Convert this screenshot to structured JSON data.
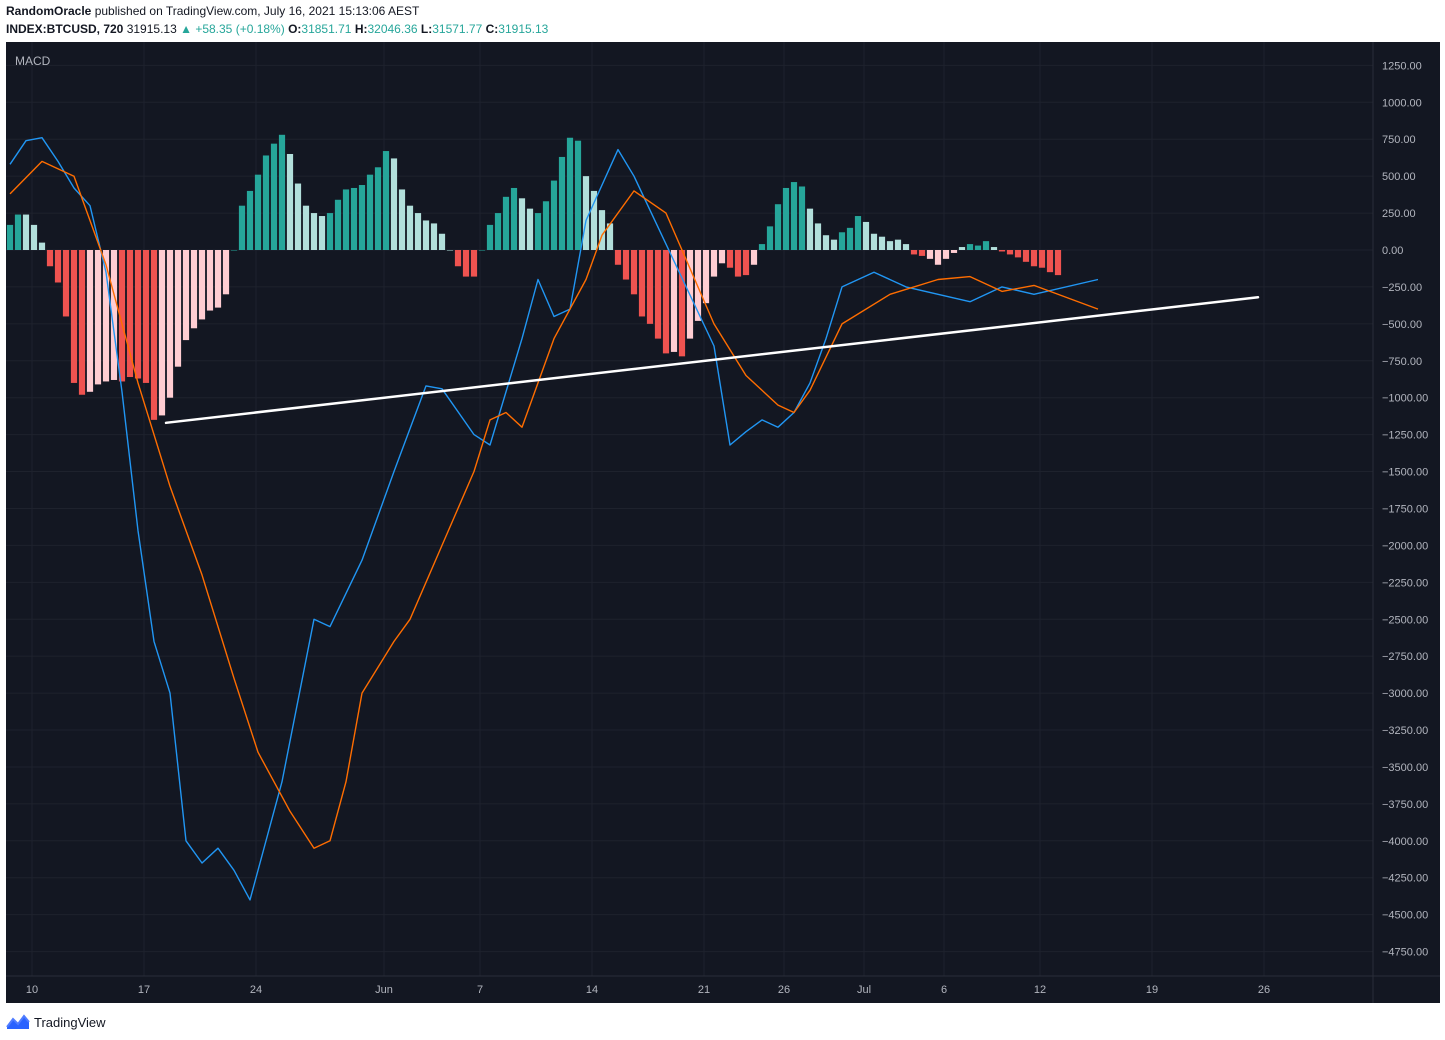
{
  "header": {
    "author": "RandomOracle",
    "published_text": "published on TradingView.com, July 16, 2021 15:13:06 AEST",
    "symbol": "INDEX:BTCUSD, 720",
    "last_price": "31915.13",
    "change": "▲ +58.35 (+0.18%)",
    "o_label": "O:",
    "o_value": "31851.71",
    "h_label": "H:",
    "h_value": "32046.36",
    "l_label": "L:",
    "l_value": "31571.77",
    "c_label": "C:",
    "c_value": "31915.13"
  },
  "footer": {
    "brand": "TradingView"
  },
  "colors": {
    "background": "#131722",
    "macd_line": "#2196f3",
    "signal_line": "#ff6d00",
    "hist_pos_strong": "#26a69a",
    "hist_pos_weak": "#b2dfdb",
    "hist_neg_strong": "#ef5350",
    "hist_neg_weak": "#ffcdd2",
    "trendline": "#ffffff",
    "axis_text": "#b2b5be"
  },
  "chart_data": {
    "type": "line",
    "title": "MACD",
    "xlabel": "",
    "ylabel": "",
    "ylim": [
      -4900,
      1400
    ],
    "x_ticks": [
      {
        "i": 0,
        "label": "10"
      },
      {
        "i": 14,
        "label": "17"
      },
      {
        "i": 28,
        "label": "24"
      },
      {
        "i": 44,
        "label": "Jun"
      },
      {
        "i": 56,
        "label": "7"
      },
      {
        "i": 70,
        "label": "14"
      },
      {
        "i": 84,
        "label": "21"
      },
      {
        "i": 94,
        "label": "26"
      },
      {
        "i": 104,
        "label": "Jul"
      },
      {
        "i": 114,
        "label": "6"
      },
      {
        "i": 126,
        "label": "12"
      },
      {
        "i": 140,
        "label": "19"
      },
      {
        "i": 154,
        "label": "26"
      }
    ],
    "y_ticks": [
      1250,
      1000,
      750,
      500,
      250,
      0,
      -250,
      -500,
      -750,
      -1000,
      -1250,
      -1500,
      -1750,
      -2000,
      -2250,
      -2500,
      -2750,
      -3000,
      -3250,
      -3500,
      -3750,
      -4000,
      -4250,
      -4500,
      -4750
    ],
    "y_tick_labels": [
      "1250.00",
      "1000.00",
      "750.00",
      "500.00",
      "250.00",
      "0.00",
      "−250.00",
      "−500.00",
      "−750.00",
      "−1000.00",
      "−1250.00",
      "−1500.00",
      "−1750.00",
      "−2000.00",
      "−2250.00",
      "−2500.00",
      "−2750.00",
      "−3000.00",
      "−3250.00",
      "−3500.00",
      "−3750.00",
      "−4000.00",
      "−4250.00",
      "−4500.00",
      "−4750.00"
    ],
    "series": [
      {
        "name": "MACD",
        "type": "line",
        "values": [
          580,
          740,
          760,
          600,
          420,
          300,
          -150,
          -960,
          -1900,
          -2650,
          -3000,
          -4000,
          -4150,
          -4050,
          -4200,
          -4400,
          -3600,
          -2500,
          -2550,
          -2100,
          -1500,
          -920,
          -940,
          -1250,
          -1320,
          -600,
          -200,
          -450,
          -400,
          200,
          680,
          500,
          -650,
          -1320,
          -1230,
          -1150,
          -1200,
          -1100,
          -900,
          -600,
          -250,
          -150,
          -250,
          -300,
          -350,
          -250,
          -300,
          -200
        ],
        "x_index": [
          0,
          2,
          4,
          6,
          8,
          10,
          12,
          14,
          16,
          18,
          20,
          22,
          24,
          26,
          28,
          30,
          34,
          38,
          40,
          44,
          48,
          52,
          54,
          58,
          60,
          64,
          66,
          68,
          70,
          72,
          76,
          78,
          88,
          90,
          92,
          94,
          96,
          98,
          100,
          102,
          104,
          108,
          112,
          116,
          120,
          124,
          128,
          136
        ]
      },
      {
        "name": "Signal",
        "type": "line",
        "values": [
          380,
          600,
          500,
          -100,
          -900,
          -1600,
          -2200,
          -2900,
          -3400,
          -3800,
          -4050,
          -4000,
          -3600,
          -3000,
          -2650,
          -2500,
          -2000,
          -1500,
          -1150,
          -1100,
          -1200,
          -900,
          -600,
          -200,
          100,
          400,
          250,
          -500,
          -850,
          -1050,
          -1100,
          -950,
          -500,
          -300,
          -200,
          -180,
          -280,
          -240,
          -400
        ],
        "x_index": [
          0,
          4,
          8,
          12,
          16,
          20,
          24,
          28,
          31,
          35,
          38,
          40,
          42,
          44,
          48,
          50,
          54,
          58,
          60,
          62,
          64,
          66,
          68,
          72,
          74,
          78,
          82,
          88,
          92,
          96,
          98,
          100,
          104,
          110,
          116,
          120,
          124,
          128,
          136
        ]
      },
      {
        "name": "Histogram",
        "type": "bar",
        "values": [
          170,
          240,
          240,
          170,
          50,
          -110,
          -220,
          -450,
          -900,
          -980,
          -960,
          -910,
          -890,
          -880,
          -890,
          -860,
          -870,
          -900,
          -1150,
          -1120,
          -1000,
          -790,
          -610,
          -530,
          -470,
          -410,
          -390,
          -300,
          0,
          300,
          400,
          510,
          640,
          720,
          780,
          650,
          450,
          300,
          250,
          230,
          250,
          340,
          410,
          420,
          440,
          510,
          560,
          670,
          620,
          410,
          300,
          250,
          200,
          180,
          110,
          0,
          -110,
          -180,
          -180,
          0,
          170,
          250,
          360,
          420,
          350,
          280,
          250,
          330,
          470,
          630,
          760,
          740,
          500,
          400,
          270,
          180,
          -100,
          -200,
          -300,
          -450,
          -500,
          -600,
          -700,
          -690,
          -720,
          -600,
          -480,
          -360,
          -180,
          -90,
          -120,
          -180,
          -170,
          -100,
          40,
          160,
          310,
          420,
          460,
          430,
          280,
          180,
          100,
          70,
          120,
          150,
          230,
          190,
          110,
          90,
          60,
          70,
          40,
          -30,
          -40,
          -60,
          -100,
          -60,
          -20,
          20,
          40,
          30,
          60,
          20,
          -10,
          -30,
          -50,
          -80,
          -110,
          -120,
          -150,
          -170
        ],
        "color_key": "pos_strong,pos_strong,pos_weak,pos_weak,pos_weak,neg_strong,neg_strong,neg_strong,neg_strong,neg_strong,neg_weak,neg_weak,neg_weak,neg_weak,neg_strong,neg_strong,neg_strong,neg_strong,neg_strong,neg_weak,neg_weak,neg_weak,neg_weak,neg_weak,neg_weak,neg_weak,neg_weak,neg_weak,pos_strong,pos_strong,pos_strong,pos_strong,pos_strong,pos_strong,pos_strong,pos_weak,pos_weak,pos_weak,pos_weak,pos_weak,pos_strong,pos_strong,pos_strong,pos_strong,pos_strong,pos_strong,pos_strong,pos_strong,pos_weak,pos_weak,pos_weak,pos_weak,pos_weak,pos_weak,pos_weak,pos_weak,neg_strong,neg_strong,neg_strong,pos_strong,pos_strong,pos_strong,pos_strong,pos_strong,pos_weak,pos_weak,pos_strong,pos_strong,pos_strong,pos_strong,pos_strong,pos_strong,pos_weak,pos_weak,pos_weak,pos_weak,neg_strong,neg_strong,neg_strong,neg_strong,neg_strong,neg_strong,neg_strong,neg_weak,neg_strong,neg_weak,neg_weak,neg_weak,neg_weak,neg_weak,neg_strong,neg_strong,neg_strong,neg_weak,pos_strong,pos_strong,pos_strong,pos_strong,pos_strong,pos_strong,pos_weak,pos_weak,pos_weak,pos_weak,pos_strong,pos_strong,pos_strong,pos_weak,pos_weak,pos_weak,pos_weak,pos_weak,pos_weak,neg_strong,neg_strong,neg_weak,neg_weak,neg_weak,neg_weak,pos_weak,pos_strong,pos_strong,pos_strong,pos_weak,neg_strong,neg_strong,neg_strong,neg_strong,neg_strong,neg_strong,neg_strong,neg_strong"
      }
    ],
    "trendline": {
      "x_index_start": 19.5,
      "value_start": -1170,
      "x_index_end": 156,
      "value_end": -320
    }
  }
}
